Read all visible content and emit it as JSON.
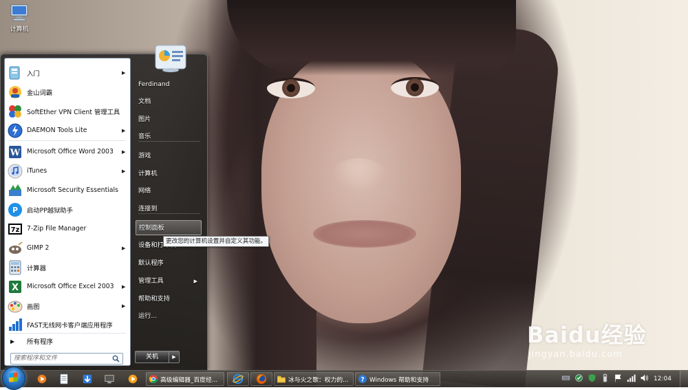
{
  "desktop": {
    "icon_label": "计算机"
  },
  "watermark": {
    "logo_text": "Baidu经验",
    "url": "jingyan.baidu.com"
  },
  "start_menu": {
    "programs": [
      {
        "label": "入门",
        "icon": "getting-started-icon",
        "has_submenu": true
      },
      {
        "label": "金山词霸",
        "icon": "kingsoft-powerword-icon",
        "has_submenu": false
      },
      {
        "label": "SoftEther VPN Client 管理工具",
        "icon": "softether-vpn-icon",
        "has_submenu": false
      },
      {
        "label": "DAEMON Tools Lite",
        "icon": "daemon-tools-icon",
        "has_submenu": true
      },
      {
        "label": "Microsoft Office Word 2003",
        "icon": "word-icon",
        "has_submenu": true
      },
      {
        "label": "iTunes",
        "icon": "itunes-icon",
        "has_submenu": true
      },
      {
        "label": "Microsoft Security Essentials",
        "icon": "security-essentials-icon",
        "has_submenu": false
      },
      {
        "label": "启动PP越狱助手",
        "icon": "pp-assistant-icon",
        "has_submenu": false
      },
      {
        "label": "7-Zip File Manager",
        "icon": "7zip-icon",
        "has_submenu": false
      },
      {
        "label": "GIMP 2",
        "icon": "gimp-icon",
        "has_submenu": true
      },
      {
        "label": "计算器",
        "icon": "calculator-icon",
        "has_submenu": false
      },
      {
        "label": "Microsoft Office Excel 2003",
        "icon": "excel-icon",
        "has_submenu": true
      },
      {
        "label": "画图",
        "icon": "paint-icon",
        "has_submenu": true
      },
      {
        "label": "FAST无线网卡客户端应用程序",
        "icon": "wireless-adapter-icon",
        "has_submenu": false
      }
    ],
    "all_programs_label": "所有程序",
    "search_placeholder": "搜索程序和文件",
    "right_items": [
      {
        "label": "Ferdinand",
        "highlight": false,
        "has_submenu": false
      },
      {
        "label": "文档",
        "highlight": false,
        "has_submenu": false
      },
      {
        "label": "图片",
        "highlight": false,
        "has_submenu": false
      },
      {
        "label": "音乐",
        "highlight": false,
        "has_submenu": false
      },
      {
        "label": "游戏",
        "highlight": false,
        "has_submenu": false
      },
      {
        "label": "计算机",
        "highlight": false,
        "has_submenu": false
      },
      {
        "label": "网络",
        "highlight": false,
        "has_submenu": false
      },
      {
        "label": "连接到",
        "highlight": false,
        "has_submenu": false
      },
      {
        "label": "控制面板",
        "highlight": true,
        "has_submenu": false
      },
      {
        "label": "设备和打印机",
        "highlight": false,
        "has_submenu": false
      },
      {
        "label": "默认程序",
        "highlight": false,
        "has_submenu": false
      },
      {
        "label": "管理工具",
        "highlight": false,
        "has_submenu": true
      },
      {
        "label": "帮助和支持",
        "highlight": false,
        "has_submenu": false
      },
      {
        "label": "运行...",
        "highlight": false,
        "has_submenu": false
      }
    ],
    "shutdown_label": "关机",
    "tooltip": "更改您的计算机设置并自定义其功能。"
  },
  "taskbar": {
    "quick_launch": [
      "media-player-icon",
      "document-icon",
      "shield-download-icon",
      "monitor-icon",
      "video-player-icon"
    ],
    "tasks": [
      {
        "label": "高级编辑器_百度经...",
        "icon": "chrome-icon"
      },
      {
        "label": "",
        "icon": "ie-icon"
      },
      {
        "label": "",
        "icon": "firefox-icon"
      },
      {
        "label": "冰与火之歌：权力的...",
        "icon": "folder-icon"
      },
      {
        "label": "Windows 帮助和支持",
        "icon": "help-icon"
      }
    ],
    "tray_icons": [
      "keyboard-icon",
      "network-status-icon",
      "security-shield-icon",
      "usb-icon",
      "flag-icon",
      "wifi-signal-icon",
      "volume-icon"
    ],
    "clock": "12:04"
  },
  "colors": {
    "accent": "#2c78c9",
    "menu_bg": "#2d2a28",
    "highlight_border": "#ffffff"
  }
}
